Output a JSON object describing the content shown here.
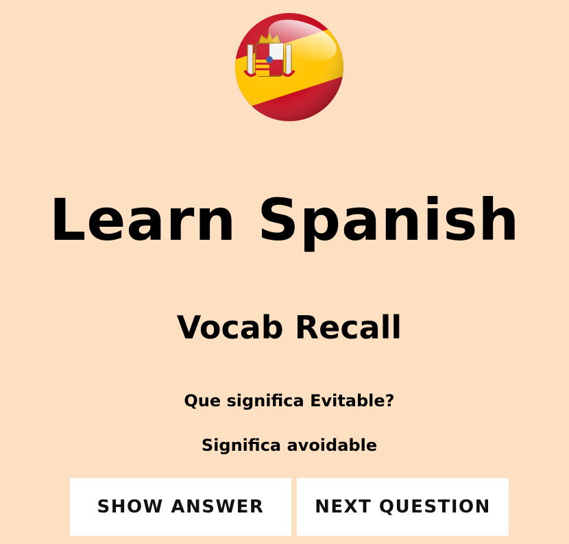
{
  "header": {
    "flag_icon": "spain-flag-globe-icon",
    "title": "Learn Spanish"
  },
  "quiz": {
    "mode_title": "Vocab Recall",
    "question": "Que significa Evitable?",
    "answer": "Significa avoidable"
  },
  "actions": {
    "show_answer_label": "SHOW ANSWER",
    "next_question_label": "NEXT QUESTION"
  },
  "colors": {
    "background": "#fde0c2",
    "button_bg": "#ffffff",
    "flag_red": "#c60b1e",
    "flag_yellow": "#ffc400"
  }
}
